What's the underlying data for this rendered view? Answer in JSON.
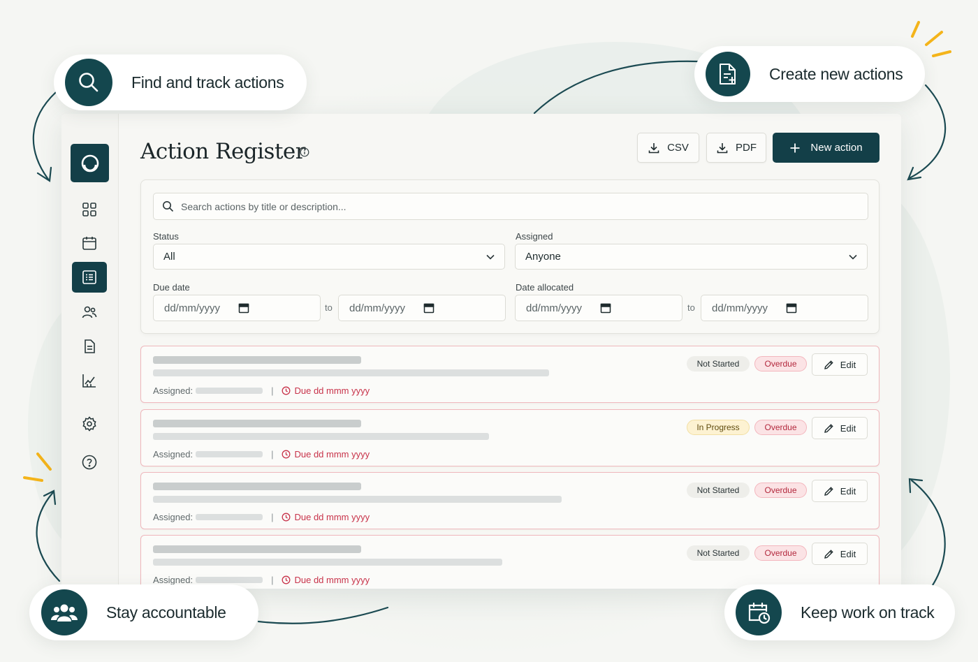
{
  "callouts": {
    "find": "Find and track actions",
    "create": "Create new actions",
    "accountable": "Stay accountable",
    "on_track": "Keep work on track"
  },
  "header": {
    "title": "Action Register",
    "csv_label": "CSV",
    "pdf_label": "PDF",
    "new_action_label": "New action"
  },
  "sidebar": {
    "items": [
      {
        "icon": "dashboard-grid-icon"
      },
      {
        "icon": "calendar-icon"
      },
      {
        "icon": "action-list-icon",
        "active": true
      },
      {
        "icon": "users-icon"
      },
      {
        "icon": "document-icon"
      },
      {
        "icon": "analytics-chart-icon"
      },
      {
        "icon": "settings-gear-icon"
      },
      {
        "icon": "help-icon"
      }
    ]
  },
  "filters": {
    "search_placeholder": "Search actions by title or description...",
    "status_label": "Status",
    "status_value": "All",
    "assigned_label": "Assigned",
    "assigned_value": "Anyone",
    "due_date_label": "Due date",
    "date_allocated_label": "Date allocated",
    "date_placeholder": "dd/mm/yyyy",
    "to_label": "to"
  },
  "actions": [
    {
      "status": "Not Started",
      "flag": "Overdue",
      "assigned_label": "Assigned:",
      "due": "Due dd mmm yyyy",
      "edit_label": "Edit"
    },
    {
      "status": "In Progress",
      "flag": "Overdue",
      "assigned_label": "Assigned:",
      "due": "Due dd mmm yyyy",
      "edit_label": "Edit"
    },
    {
      "status": "Not Started",
      "flag": "Overdue",
      "assigned_label": "Assigned:",
      "due": "Due dd mmm yyyy",
      "edit_label": "Edit"
    },
    {
      "status": "Not Started",
      "flag": "Overdue",
      "assigned_label": "Assigned:",
      "due": "Due dd mmm yyyy",
      "edit_label": "Edit"
    }
  ],
  "colors": {
    "primary": "#133f48",
    "overdue": "#c8334a",
    "accent_spark": "#f4b41a"
  }
}
